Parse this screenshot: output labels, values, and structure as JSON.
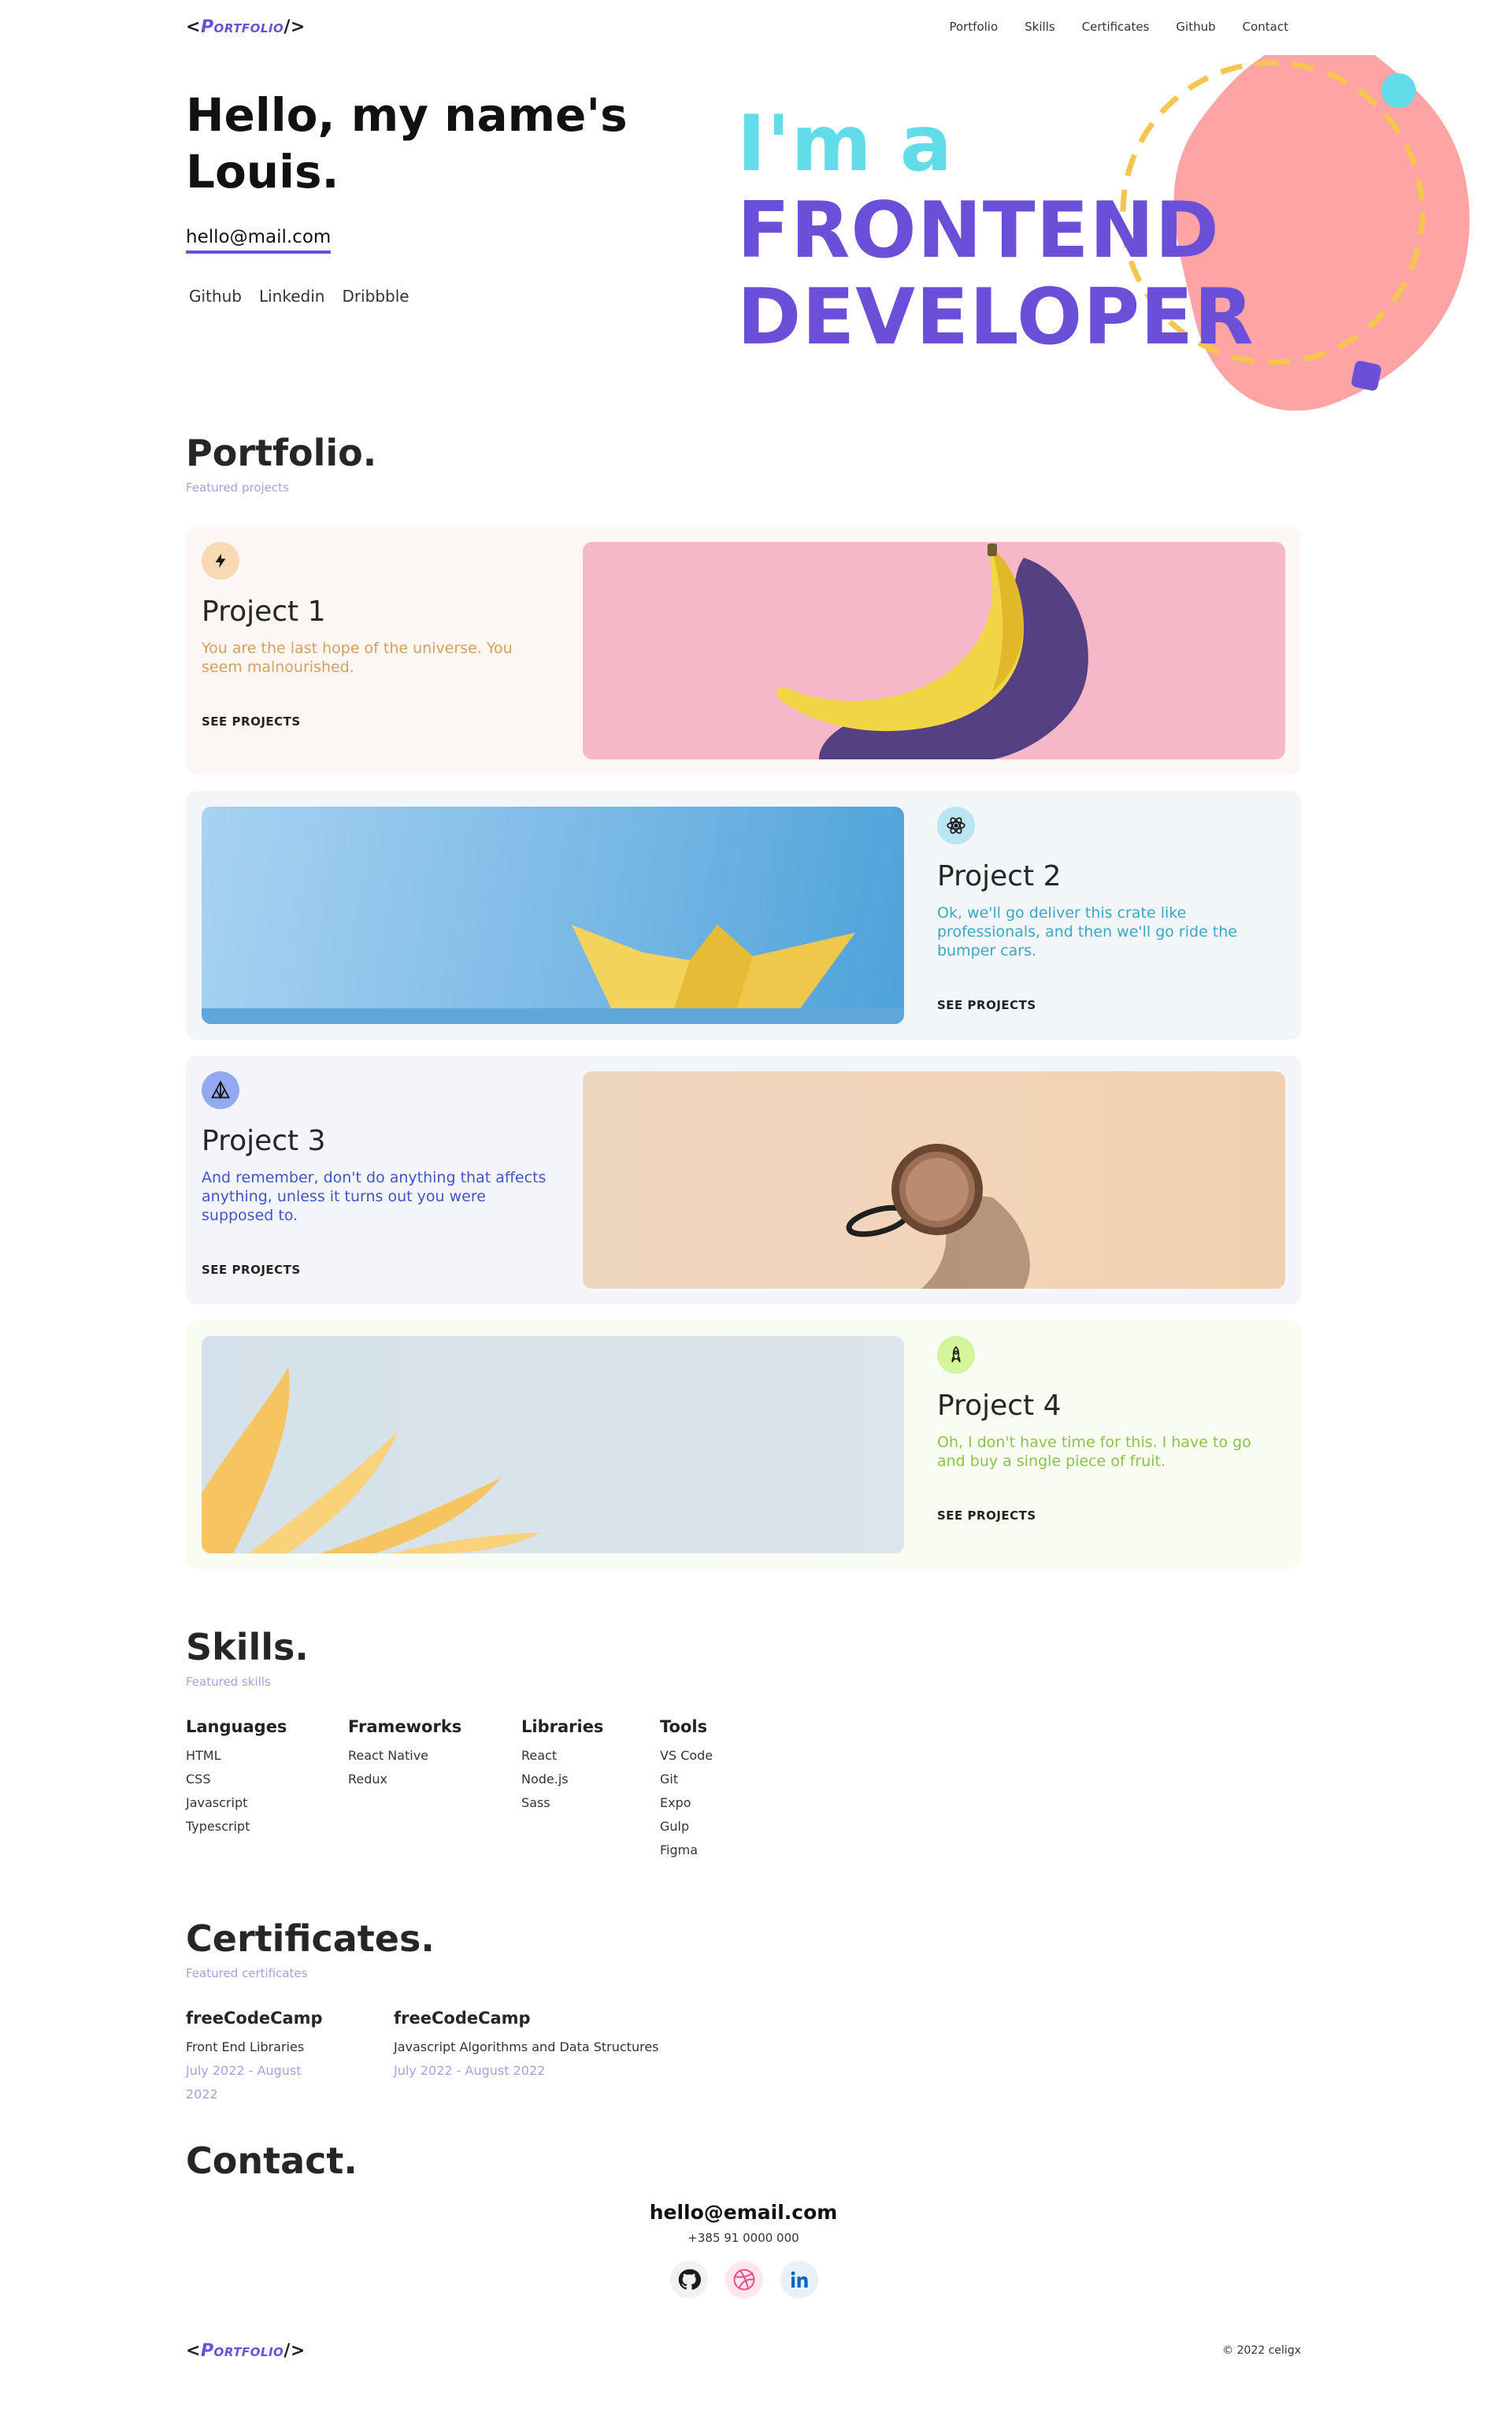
{
  "header": {
    "logo_open": "<",
    "logo_word": "Portfolio",
    "logo_close": "/>",
    "nav": [
      "Portfolio",
      "Skills",
      "Certificates",
      "Github",
      "Contact"
    ]
  },
  "hero": {
    "greeting": "Hello, my name's Louis.",
    "email": "hello@mail.com",
    "socials": [
      "Github",
      "Linkedin",
      "Dribbble"
    ],
    "line1": "I'm a",
    "line2": "FRONTEND",
    "line3": "DEVELOPER"
  },
  "portfolio": {
    "title": "Portfolio.",
    "subtitle": "Featured projects",
    "projects": [
      {
        "title": "Project 1",
        "desc": "You are the last hope of the universe. You seem malnourished.",
        "button": "SEE PROJECTS",
        "icon": "bolt-icon",
        "accent": "#d4a05a"
      },
      {
        "title": "Project 2",
        "desc": "Ok, we'll go deliver this crate like professionals, and then we'll go ride the bumper cars.",
        "button": "SEE PROJECTS",
        "icon": "atom-icon",
        "accent": "#3aa7c9"
      },
      {
        "title": "Project 3",
        "desc": "And remember, don't do anything that affects anything, unless it turns out you were supposed to.",
        "button": "SEE PROJECTS",
        "icon": "triangles-icon",
        "accent": "#3f55c8"
      },
      {
        "title": "Project 4",
        "desc": "Oh, I don't have time for this. I have to go and buy a single piece of fruit.",
        "button": "SEE PROJECTS",
        "icon": "rocket-icon",
        "accent": "#8bc34a"
      }
    ]
  },
  "skills": {
    "title": "Skills.",
    "subtitle": "Featured skills",
    "groups": [
      {
        "name": "Languages",
        "items": [
          "HTML",
          "CSS",
          "Javascript",
          "Typescript"
        ]
      },
      {
        "name": "Frameworks",
        "items": [
          "React Native",
          "Redux"
        ]
      },
      {
        "name": "Libraries",
        "items": [
          "React",
          "Node.js",
          "Sass"
        ]
      },
      {
        "name": "Tools",
        "items": [
          "VS Code",
          "Git",
          "Expo",
          "Gulp",
          "Figma"
        ]
      }
    ]
  },
  "certificates": {
    "title": "Certificates.",
    "subtitle": "Featured certificates",
    "items": [
      {
        "issuer": "freeCodeCamp",
        "name": "Front End Libraries",
        "dates": "July 2022 - August 2022"
      },
      {
        "issuer": "freeCodeCamp",
        "name": "Javascript Algorithms and Data Structures",
        "dates": "July 2022 - August 2022"
      }
    ]
  },
  "contact": {
    "title": "Contact.",
    "email": "hello@email.com",
    "phone": "+385 91 0000 000"
  },
  "footer": {
    "copyright": "© 2022 celigx"
  }
}
